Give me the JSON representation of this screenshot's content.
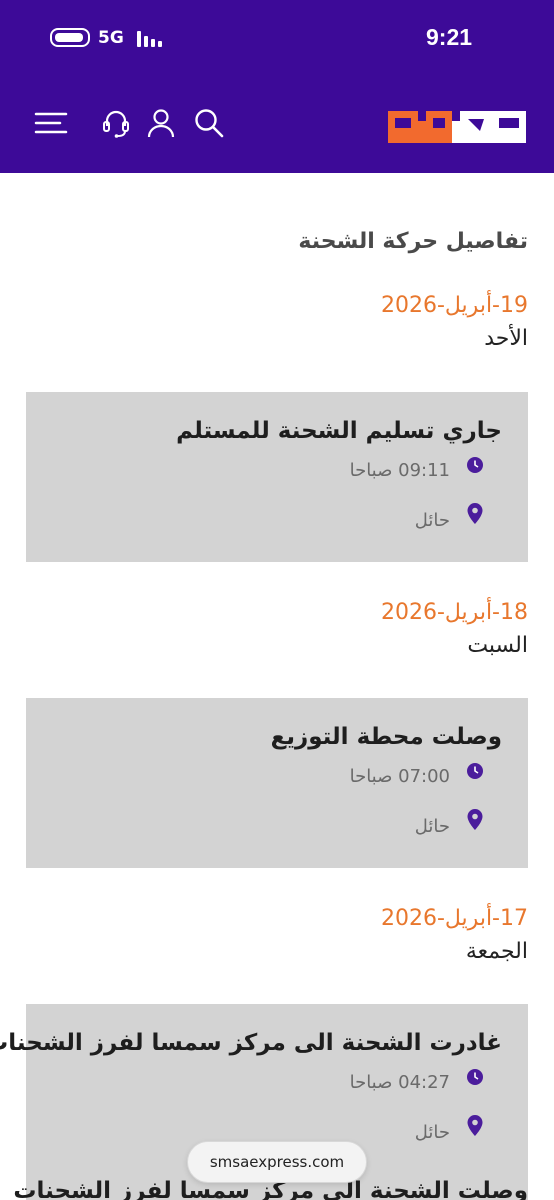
{
  "status_bar": {
    "network": "5G",
    "time": "9:21"
  },
  "header": {
    "logo_icon": "smsa-logo",
    "icons": [
      "menu-icon",
      "headset-icon",
      "user-icon",
      "search-icon"
    ],
    "colors": {
      "background": "#3d0a98",
      "logo_orange": "#f26a2e",
      "logo_white": "#ffffff"
    }
  },
  "page": {
    "title": "تفاصيل حركة الشحنة"
  },
  "tracking": [
    {
      "date": "19-أبريل-2026",
      "day": "الأحد",
      "events": [
        {
          "title": "جاري تسليم الشحنة للمستلم",
          "time": "09:11 صباحا",
          "location": "حائل"
        }
      ]
    },
    {
      "date": "18-أبريل-2026",
      "day": "السبت",
      "events": [
        {
          "title": "وصلت محطة التوزيع",
          "time": "07:00 صباحا",
          "location": "حائل"
        }
      ]
    },
    {
      "date": "17-أبريل-2026",
      "day": "الجمعة",
      "events": [
        {
          "title": "غادرت الشحنة الى مركز سمسا لفرز الشحنات",
          "time": "04:27 صباحا",
          "location": "حائل"
        },
        {
          "title": "وصلت الشحنة الى مركز سمسا لفرز الشحنات"
        }
      ]
    }
  ],
  "accent_colors": {
    "date": "#e8772d",
    "icons": "#4b1d9c",
    "card": "#d3d3d3"
  },
  "browser": {
    "url": "smsaexpress.com"
  }
}
